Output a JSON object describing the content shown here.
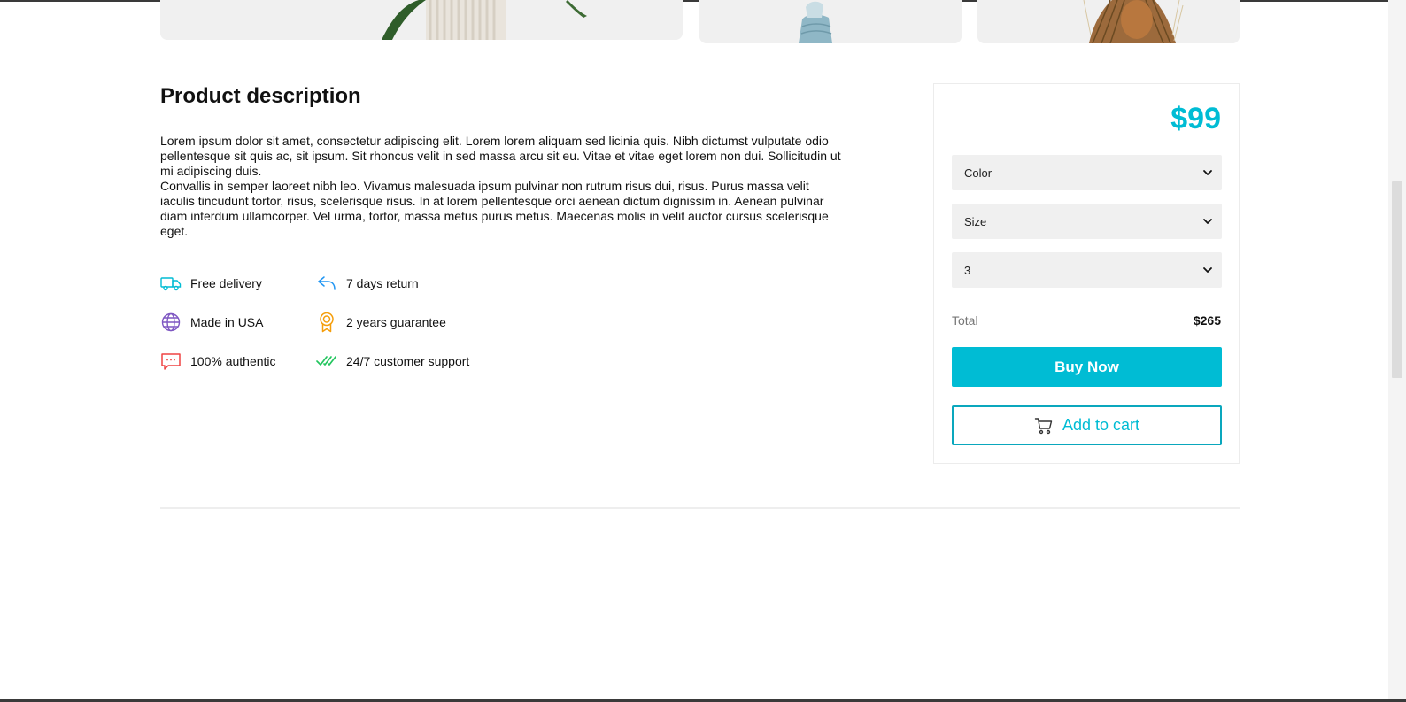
{
  "gallery": {
    "images": [
      {
        "subject": "plant-vase-image"
      },
      {
        "subject": "blue-bag-image"
      },
      {
        "subject": "dried-flowers-image"
      }
    ]
  },
  "product": {
    "description_title": "Product description",
    "description_paragraphs": [
      "Lorem ipsum dolor sit amet, consectetur adipiscing elit. Lorem lorem aliquam sed licinia quis. Nibh dictumst vulputate odio pellentesque sit quis ac, sit ipsum. Sit rhoncus velit in sed massa arcu sit eu. Vitae et vitae eget lorem non dui. Sollicitudin ut mi adipiscing duis.",
      "Convallis in semper laoreet nibh leo. Vivamus malesuada ipsum pulvinar non rutrum risus dui, risus. Purus massa velit iaculis tincudunt tortor, risus, scelerisque risus. In at lorem pellentesque orci aenean dictum dignissim in. Aenean pulvinar diam interdum ullamcorper. Vel urma, tortor, massa metus purus metus. Maecenas molis in velit auctor cursus scelerisque eget."
    ],
    "features": [
      {
        "label": "Free delivery",
        "icon": "truck-icon",
        "color": "#00bcd4"
      },
      {
        "label": "7 days return",
        "icon": "return-arrow-icon",
        "color": "#2196f3"
      },
      {
        "label": "Made in USA",
        "icon": "globe-icon",
        "color": "#7e57c2"
      },
      {
        "label": "2 years guarantee",
        "icon": "award-icon",
        "color": "#f59e0b"
      },
      {
        "label": "100% authentic",
        "icon": "chat-bubble-icon",
        "color": "#ef4444"
      },
      {
        "label": "24/7 customer support",
        "icon": "double-check-icon",
        "color": "#22c55e"
      }
    ]
  },
  "purchase": {
    "price": "$99",
    "color_select": "Color",
    "size_select": "Size",
    "quantity_select": "3",
    "total_label": "Total",
    "total_value": "$265",
    "buy_label": "Buy Now",
    "cart_label": "Add to cart",
    "accent_color": "#00bcd4"
  }
}
